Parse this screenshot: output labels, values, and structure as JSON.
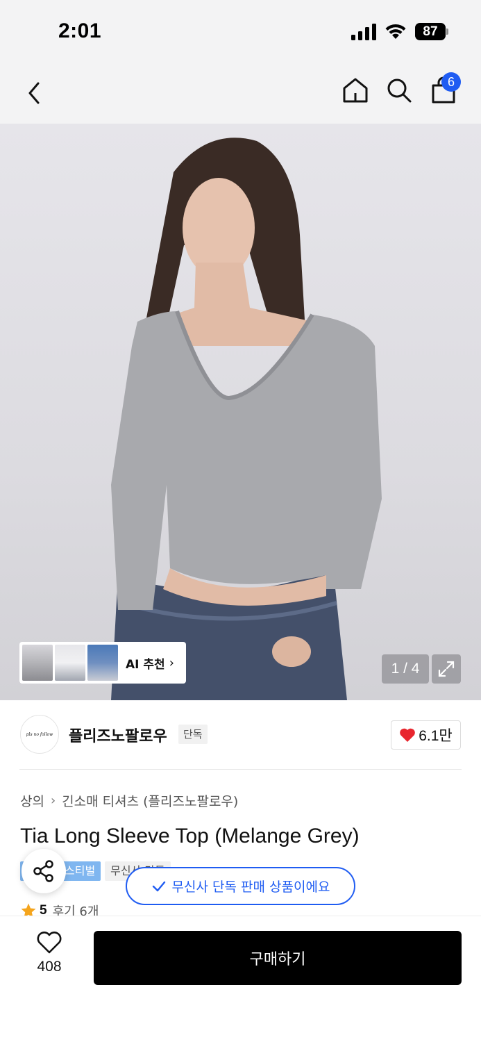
{
  "status_bar": {
    "time": "2:01",
    "battery": "87",
    "icons": [
      "cellular-signal-icon",
      "wifi-icon",
      "battery-icon"
    ]
  },
  "nav": {
    "icons": [
      "back-icon",
      "home-icon",
      "search-icon",
      "shopping-bag-icon"
    ],
    "cart_badge": "6"
  },
  "gallery": {
    "page_indicator": "1 / 4",
    "ai_recommend_label": "AI 추천",
    "expand_icon": "expand-icon"
  },
  "brand": {
    "name": "플리즈노팔로우",
    "exclusive_tag": "단독",
    "likes": "6.1만"
  },
  "breadcrumb": [
    "상의",
    "긴소매 티셔츠 (플리즈노팔로우)"
  ],
  "product": {
    "title": "Tia Long Sleeve Top (Melange Grey)",
    "festival_tag": "스티벌",
    "musinsa_tag": "무신사 단독",
    "rating": "5",
    "review_label": "후기 6개"
  },
  "toast": {
    "text": "무신사 단독 판매 상품이에요"
  },
  "bottom_bar": {
    "wish_count": "408",
    "buy_label": "구매하기"
  },
  "colors": {
    "accent_blue": "#1f5cf2",
    "heart_red": "#e8262e",
    "star_orange": "#f5a51d",
    "festival_blue": "#7fb6f0"
  }
}
